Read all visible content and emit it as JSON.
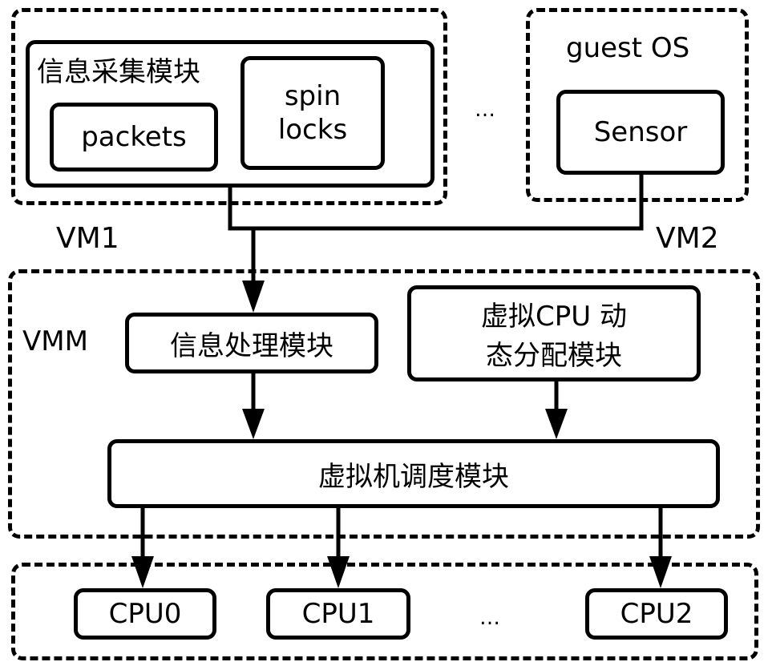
{
  "vm1": {
    "label": "VM1",
    "collector": {
      "title": "信息采集模块",
      "items": [
        "packets",
        "spin\nlocks"
      ]
    }
  },
  "vm2": {
    "label": "VM2",
    "os_label": "guest OS",
    "sensor": "Sensor"
  },
  "vm_ellipsis": "…",
  "vmm": {
    "label": "VMM",
    "info_processing": "信息处理模块",
    "vcpu_allocation_line1": "虚拟CPU 动",
    "vcpu_allocation_line2": "态分配模块",
    "scheduler": "虚拟机调度模块"
  },
  "cpus": {
    "items": [
      "CPU0",
      "CPU1",
      "CPU2"
    ],
    "ellipsis": "…"
  }
}
